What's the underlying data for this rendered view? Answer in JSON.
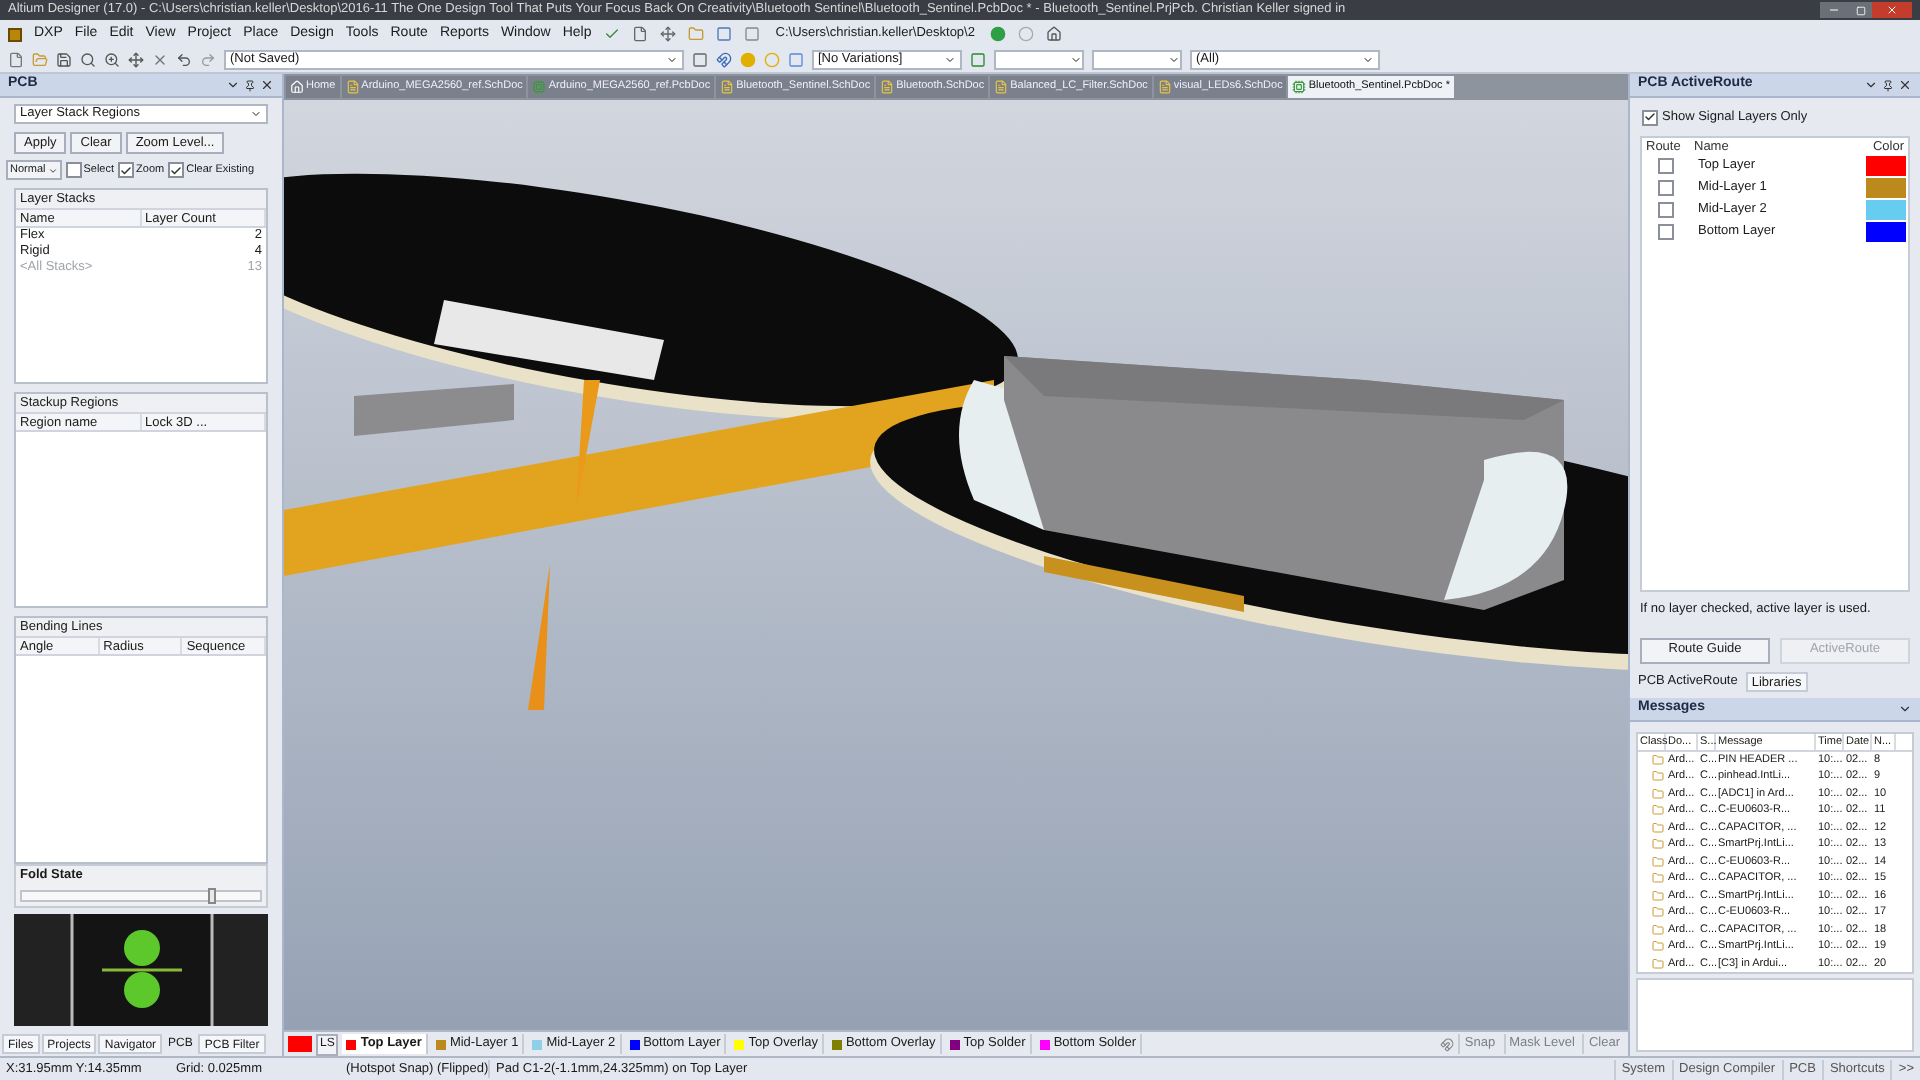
{
  "window": {
    "title": "Altium Designer (17.0) - C:\\Users\\christian.keller\\Desktop\\2016-11 The One Design Tool That Puts Your Focus Back On Creativity\\Bluetooth Sentinel\\Bluetooth_Sentinel.PcbDoc * - Bluetooth_Sentinel.PrjPcb. Christian Keller signed in"
  },
  "menu": [
    "DXP",
    "File",
    "Edit",
    "View",
    "Project",
    "Place",
    "Design",
    "Tools",
    "Route",
    "Reports",
    "Window",
    "Help"
  ],
  "toolbar": {
    "path": "C:\\Users\\christian.keller\\Desktop\\2",
    "saved": "(Not Saved)",
    "variations": "[No Variations]",
    "filter": "(All)"
  },
  "left_panel": {
    "title": "PCB",
    "mode": "Layer Stack Regions",
    "buttons": [
      "Apply",
      "Clear",
      "Zoom Level..."
    ],
    "mask_mode": "Normal",
    "options": [
      {
        "label": "Select",
        "checked": false
      },
      {
        "label": "Zoom",
        "checked": true
      },
      {
        "label": "Clear Existing",
        "checked": true
      }
    ],
    "layer_stacks": {
      "title": "Layer Stacks",
      "columns": [
        "Name",
        "Layer Count"
      ],
      "rows": [
        {
          "name": "Flex",
          "count": "2",
          "disabled": false
        },
        {
          "name": "Rigid",
          "count": "4",
          "disabled": false
        },
        {
          "name": "<All Stacks>",
          "count": "13",
          "disabled": true
        }
      ]
    },
    "stackup_regions": {
      "title": "Stackup Regions",
      "columns": [
        "Region name",
        "Lock 3D ..."
      ]
    },
    "bending_lines": {
      "title": "Bending Lines",
      "columns": [
        "Angle",
        "Radius",
        "Sequence"
      ]
    },
    "fold_state": {
      "label": "Fold State",
      "level": 0.78
    },
    "tabs": [
      {
        "label": "Files",
        "selected": false
      },
      {
        "label": "Projects",
        "selected": false
      },
      {
        "label": "Navigator",
        "selected": false
      },
      {
        "label": "PCB",
        "selected": true
      },
      {
        "label": "PCB Filter",
        "selected": false
      }
    ]
  },
  "document_tabs": [
    {
      "label": "Home",
      "kind": "home",
      "selected": false
    },
    {
      "label": "Arduino_MEGA2560_ref.SchDoc",
      "kind": "sch",
      "selected": false
    },
    {
      "label": "Arduino_MEGA2560_ref.PcbDoc",
      "kind": "pcb",
      "selected": false
    },
    {
      "label": "Bluetooth_Sentinel.SchDoc",
      "kind": "sch",
      "selected": false
    },
    {
      "label": "Bluetooth.SchDoc",
      "kind": "sch",
      "selected": false
    },
    {
      "label": "Balanced_LC_Filter.SchDoc",
      "kind": "sch",
      "selected": false
    },
    {
      "label": "visual_LEDs6.SchDoc",
      "kind": "sch",
      "selected": false
    },
    {
      "label": "Bluetooth_Sentinel.PcbDoc *",
      "kind": "pcb",
      "selected": true
    }
  ],
  "layer_bar": {
    "current": {
      "color": "#ff0000",
      "label": "LS"
    },
    "layers": [
      {
        "label": "Top Layer",
        "color": "#ff0000",
        "selected": true
      },
      {
        "label": "Mid-Layer 1",
        "color": "#bc8a1c",
        "selected": false
      },
      {
        "label": "Mid-Layer 2",
        "color": "#8fd0e6",
        "selected": false
      },
      {
        "label": "Bottom Layer",
        "color": "#0000ff",
        "selected": false
      },
      {
        "label": "Top Overlay",
        "color": "#ffff00",
        "selected": false
      },
      {
        "label": "Bottom Overlay",
        "color": "#808000",
        "selected": false
      },
      {
        "label": "Top Solder",
        "color": "#800080",
        "selected": false
      },
      {
        "label": "Bottom Solder",
        "color": "#ff00ff",
        "selected": false
      }
    ],
    "buttons": [
      "Snap",
      "Mask Level",
      "Clear"
    ]
  },
  "right_panel": {
    "title": "PCB ActiveRoute",
    "show_signal": {
      "label": "Show Signal Layers Only",
      "checked": true
    },
    "columns": [
      "Route",
      "Name",
      "Color"
    ],
    "layers": [
      {
        "name": "Top Layer",
        "checked": false,
        "color": "#ff0000"
      },
      {
        "name": "Mid-Layer 1",
        "checked": false,
        "color": "#bc8a1c"
      },
      {
        "name": "Mid-Layer 2",
        "checked": false,
        "color": "#66ccf0"
      },
      {
        "name": "Bottom Layer",
        "checked": false,
        "color": "#0000ff"
      }
    ],
    "note": "If no layer checked, active layer is used.",
    "buttons": [
      {
        "label": "Route Guide",
        "disabled": false
      },
      {
        "label": "ActiveRoute",
        "disabled": true
      }
    ],
    "tabs": [
      {
        "label": "PCB ActiveRoute",
        "selected": true
      },
      {
        "label": "Libraries",
        "selected": false
      }
    ]
  },
  "messages": {
    "title": "Messages",
    "columns": [
      "Class",
      "Do...",
      "S...",
      "Message",
      "Time",
      "Date",
      "N..."
    ],
    "rows": [
      {
        "doc": "Ard...",
        "source": "C...",
        "message": "PIN HEADER ...",
        "time": "10:...",
        "date": "02...",
        "no": "8"
      },
      {
        "doc": "Ard...",
        "source": "C...",
        "message": "pinhead.IntLi...",
        "time": "10:...",
        "date": "02...",
        "no": "9"
      },
      {
        "doc": "Ard...",
        "source": "C...",
        "message": "[ADC1] in Ard...",
        "time": "10:...",
        "date": "02...",
        "no": "10"
      },
      {
        "doc": "Ard...",
        "source": "C...",
        "message": "C-EU0603-R...",
        "time": "10:...",
        "date": "02...",
        "no": "11"
      },
      {
        "doc": "Ard...",
        "source": "C...",
        "message": "CAPACITOR, ...",
        "time": "10:...",
        "date": "02...",
        "no": "12"
      },
      {
        "doc": "Ard...",
        "source": "C...",
        "message": "SmartPrj.IntLi...",
        "time": "10:...",
        "date": "02...",
        "no": "13"
      },
      {
        "doc": "Ard...",
        "source": "C...",
        "message": "C-EU0603-R...",
        "time": "10:...",
        "date": "02...",
        "no": "14"
      },
      {
        "doc": "Ard...",
        "source": "C...",
        "message": "CAPACITOR, ...",
        "time": "10:...",
        "date": "02...",
        "no": "15"
      },
      {
        "doc": "Ard...",
        "source": "C...",
        "message": "SmartPrj.IntLi...",
        "time": "10:...",
        "date": "02...",
        "no": "16"
      },
      {
        "doc": "Ard...",
        "source": "C...",
        "message": "C-EU0603-R...",
        "time": "10:...",
        "date": "02...",
        "no": "17"
      },
      {
        "doc": "Ard...",
        "source": "C...",
        "message": "CAPACITOR, ...",
        "time": "10:...",
        "date": "02...",
        "no": "18"
      },
      {
        "doc": "Ard...",
        "source": "C...",
        "message": "SmartPrj.IntLi...",
        "time": "10:...",
        "date": "02...",
        "no": "19"
      },
      {
        "doc": "Ard...",
        "source": "C...",
        "message": "[C3] in Ardui...",
        "time": "10:...",
        "date": "02...",
        "no": "20"
      }
    ]
  },
  "status_bar": {
    "coords": "X:31.95mm Y:14.35mm",
    "grid": "Grid: 0.025mm",
    "snap": "(Hotspot Snap) (Flipped)",
    "info": "Pad C1-2(-1.1mm,24.325mm) on Top Layer",
    "buttons": [
      "System",
      "Design Compiler",
      "PCB",
      "Shortcuts",
      ">>"
    ]
  }
}
